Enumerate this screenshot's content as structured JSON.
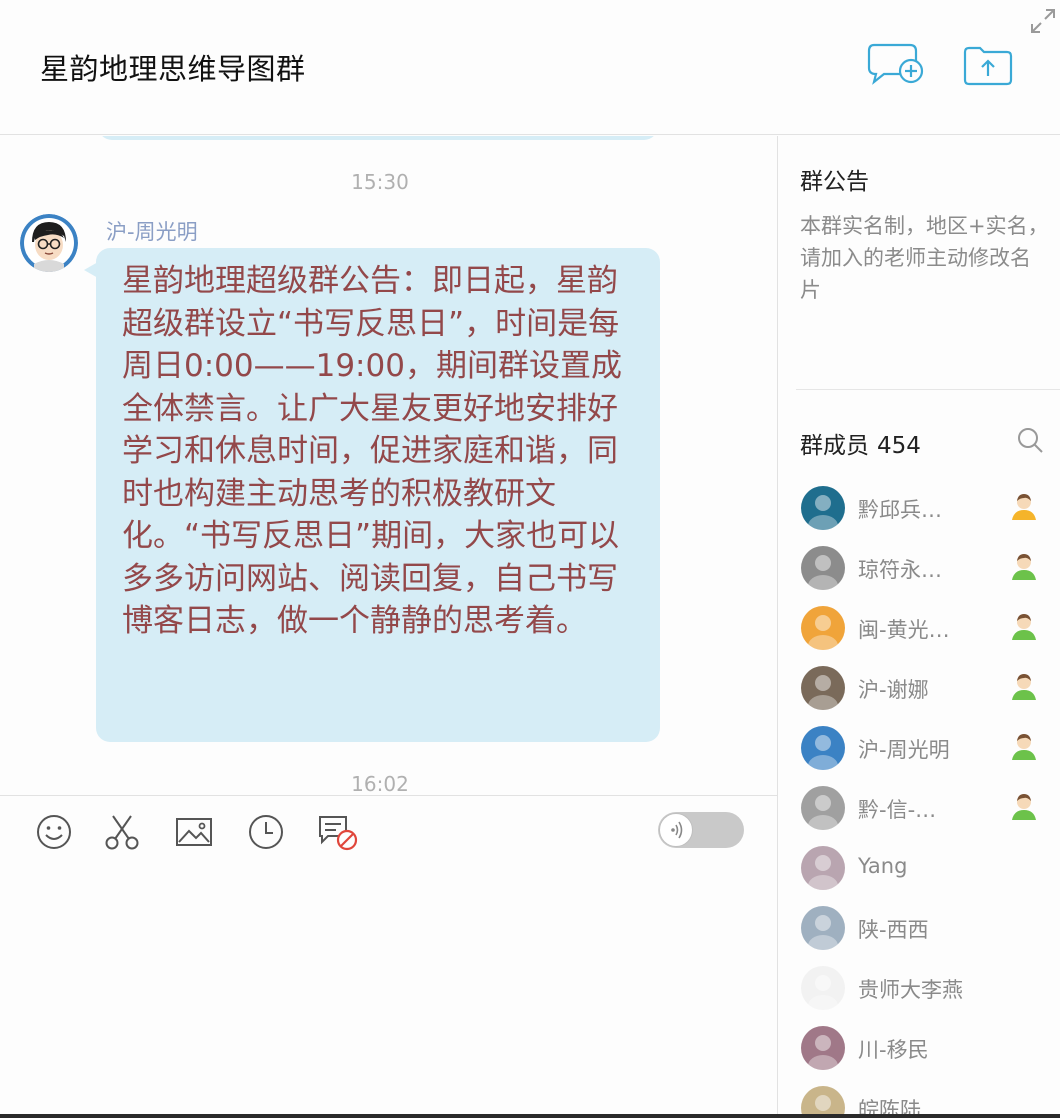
{
  "window": {
    "title": "星韵地理思维导图群"
  },
  "header": {
    "new_chat_icon": "chat-add-icon",
    "upload_icon": "folder-upload-icon",
    "expand_icon": "expand-icon"
  },
  "chat": {
    "timestamps": [
      "15:30",
      "16:02"
    ],
    "message": {
      "sender": "沪-周光明",
      "text": "星韵地理超级群公告：即日起，星韵超级群设立“书写反思日”，时间是每周日0:00——19:00，期间群设置成全体禁言。让广大星友更好地安排好学习和休息时间，促进家庭和谐，同时也构建主动思考的积极教研文化。“书写反思日”期间，大家也可以多多访问网站、阅读回复，自己书写博客日志，做一个静静的思考着。"
    }
  },
  "toolbar": {
    "items": [
      "smile-icon",
      "scissors-icon",
      "image-icon",
      "clock-icon",
      "message-block-icon"
    ],
    "voice_toggle_on": false
  },
  "sidebar": {
    "announcement_title": "群公告",
    "announcement_text": "本群实名制，地区+实名，请加入的老师主动修改名片",
    "members_title": "群成员",
    "members_count": "454",
    "members": [
      {
        "name": "黔邱兵…",
        "badge": "admin-owner",
        "avatar_color": "#1f6e8e"
      },
      {
        "name": "琼符永…",
        "badge": "admin",
        "avatar_color": "#8c8c8c"
      },
      {
        "name": "闽-黄光…",
        "badge": "admin",
        "avatar_color": "#f0a43a"
      },
      {
        "name": "沪-谢娜",
        "badge": "admin",
        "avatar_color": "#7a6a5a"
      },
      {
        "name": "沪-周光明",
        "badge": "admin",
        "avatar_color": "#3b82c4"
      },
      {
        "name": "黔-信-…",
        "badge": "admin",
        "avatar_color": "#a0a0a0"
      },
      {
        "name": "Yang",
        "badge": "",
        "avatar_color": "#b9a5b0"
      },
      {
        "name": "陕-西西",
        "badge": "",
        "avatar_color": "#9fb0c0"
      },
      {
        "name": "贵师大李燕",
        "badge": "",
        "avatar_color": "#f2f2f2"
      },
      {
        "name": "川-移民",
        "badge": "",
        "avatar_color": "#a07888"
      },
      {
        "name": "皖陈陆",
        "badge": "",
        "avatar_color": "#c9b58a"
      }
    ]
  },
  "colors": {
    "bubble": "#d6edf6",
    "message_text": "#93484a",
    "accent_icon": "#3aa9d6",
    "badge_owner": "#f5b42a",
    "badge_admin": "#6cc24a"
  }
}
